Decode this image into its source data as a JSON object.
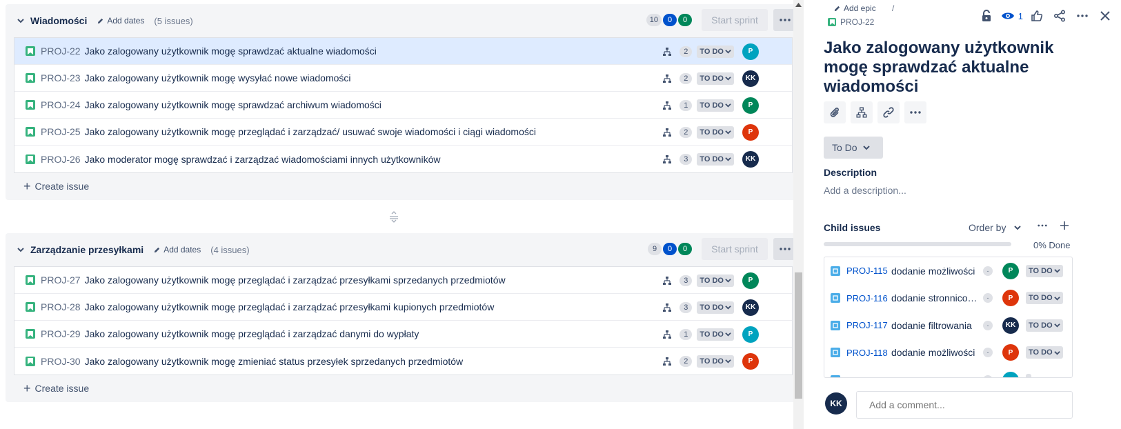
{
  "sprints": [
    {
      "name": "Wiadomości",
      "add_dates": "Add dates",
      "issue_count": "(5 issues)",
      "points": {
        "todo": "10",
        "inprogress": "0",
        "done": "0"
      },
      "start_sprint": "Start sprint",
      "issues": [
        {
          "key": "PROJ-22",
          "title": "Jako zalogowany użytkownik mogę sprawdzać aktualne wiadomości",
          "children": "2",
          "status": "TO DO",
          "assignee": "P",
          "assignee_color": "teal"
        },
        {
          "key": "PROJ-23",
          "title": "Jako zalogowany użytkownik mogę wysyłać nowe wiadomości",
          "children": "2",
          "status": "TO DO",
          "assignee": "KK",
          "assignee_color": "navy"
        },
        {
          "key": "PROJ-24",
          "title": "Jako zalogowany użytkownik mogę sprawdzać archiwum wiadomości",
          "children": "1",
          "status": "TO DO",
          "assignee": "P",
          "assignee_color": "green"
        },
        {
          "key": "PROJ-25",
          "title": "Jako zalogowany użytkownik mogę przeglądać i zarządzać/ usuwać swoje wiadomości i ciągi wiadomości",
          "children": "2",
          "status": "TO DO",
          "assignee": "P",
          "assignee_color": "red"
        },
        {
          "key": "PROJ-26",
          "title": "Jako moderator mogę sprawdzać i zarządzać wiadomościami innych użytkowników",
          "children": "3",
          "status": "TO DO",
          "assignee": "KK",
          "assignee_color": "navy"
        }
      ],
      "create_issue": "Create issue"
    },
    {
      "name": "Zarządzanie przesyłkami",
      "add_dates": "Add dates",
      "issue_count": "(4 issues)",
      "points": {
        "todo": "9",
        "inprogress": "0",
        "done": "0"
      },
      "start_sprint": "Start sprint",
      "issues": [
        {
          "key": "PROJ-27",
          "title": "Jako zalogowany użytkownik mogę przeglądać i zarządzać przesyłkami sprzedanych przedmiotów",
          "children": "3",
          "status": "TO DO",
          "assignee": "P",
          "assignee_color": "green"
        },
        {
          "key": "PROJ-28",
          "title": "Jako zalogowany użytkownik mogę przeglądać i zarządzać przesyłkami kupionych przedmiotów",
          "children": "3",
          "status": "TO DO",
          "assignee": "KK",
          "assignee_color": "navy"
        },
        {
          "key": "PROJ-29",
          "title": "Jako zalogowany użytkownik mogę przeglądać i zarządzać danymi do wypłaty",
          "children": "1",
          "status": "TO DO",
          "assignee": "P",
          "assignee_color": "teal"
        },
        {
          "key": "PROJ-30",
          "title": "Jako zalogowany użytkownik mogę zmieniać status przesyłek sprzedanych przedmiotów",
          "children": "2",
          "status": "TO DO",
          "assignee": "P",
          "assignee_color": "red"
        }
      ],
      "create_issue": "Create issue"
    }
  ],
  "detail": {
    "add_epic": "Add epic",
    "separator": "/",
    "parent_key": "PROJ-22",
    "watch_count": "1",
    "title": "Jako zalogowany użytkownik mogę sprawdzać aktualne wiadomości",
    "status": "To Do",
    "description_label": "Description",
    "description_placeholder": "Add a description...",
    "child_issues_label": "Child issues",
    "order_by": "Order by",
    "progress_done": 0,
    "progress_text": "0% Done",
    "children": [
      {
        "key": "PROJ-115",
        "title": "dodanie możliwości",
        "priority": "-",
        "assignee": "P",
        "assignee_color": "green",
        "status": "TO DO"
      },
      {
        "key": "PROJ-116",
        "title": "dodanie stronnicowania",
        "priority": "-",
        "assignee": "P",
        "assignee_color": "red",
        "status": "TO DO"
      },
      {
        "key": "PROJ-117",
        "title": "dodanie filtrowania",
        "priority": "-",
        "assignee": "KK",
        "assignee_color": "navy",
        "status": "TO DO"
      },
      {
        "key": "PROJ-118",
        "title": "dodanie możliwości",
        "priority": "-",
        "assignee": "P",
        "assignee_color": "red",
        "status": "TO DO"
      },
      {
        "key": "",
        "title": "",
        "priority": "-",
        "assignee": "",
        "assignee_color": "teal",
        "status": ""
      }
    ],
    "comment_avatar": "KK",
    "comment_placeholder": "Add a comment..."
  },
  "colors": {
    "story": "#36b37e",
    "task": "#4bade8",
    "selected_row": "#deebff",
    "link": "#0052cc"
  }
}
